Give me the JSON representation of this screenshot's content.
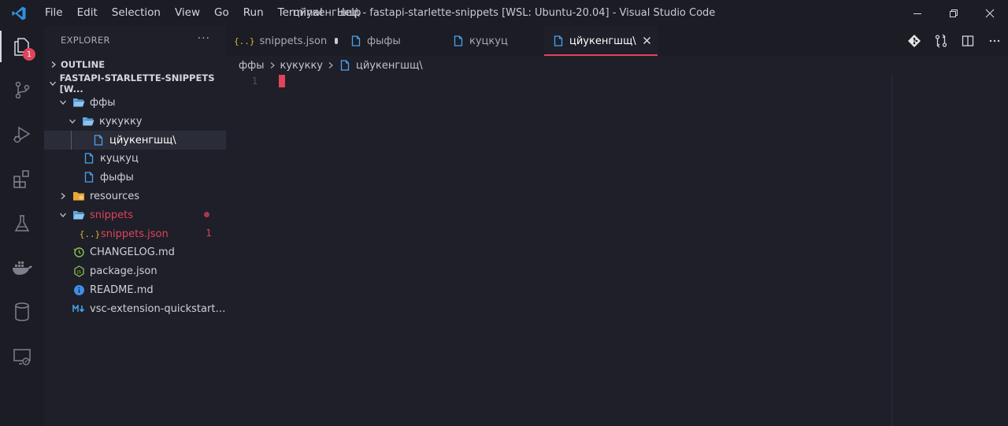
{
  "window": {
    "title": "цйукенгшщ\\ - fastapi-starlette-snippets [WSL: Ubuntu-20.04] - Visual Studio Code"
  },
  "menu": [
    "File",
    "Edit",
    "Selection",
    "View",
    "Go",
    "Run",
    "Terminal",
    "Help"
  ],
  "activity_bar": {
    "items": [
      "explorer-icon",
      "source-control-icon",
      "run-debug-icon",
      "extensions-icon",
      "testing-icon",
      "docker-icon",
      "database-icon",
      "remote-explorer-icon"
    ],
    "explorer_badge": "1"
  },
  "sidebar": {
    "header": "EXPLORER",
    "more": "···",
    "outline_label": "OUTLINE",
    "workspace_label": "FASTAPI-STARLETTE-SNIPPETS [W...",
    "tree": [
      {
        "label": "ффы"
      },
      {
        "label": "кукукку"
      },
      {
        "label": "цйукенгшщ\\"
      },
      {
        "label": "куцкуц"
      },
      {
        "label": "фыфы"
      },
      {
        "label": "resources"
      },
      {
        "label": "snippets"
      },
      {
        "label": "snippets.json",
        "problems": "1"
      },
      {
        "label": "CHANGELOG.md"
      },
      {
        "label": "package.json"
      },
      {
        "label": "README.md"
      },
      {
        "label": "vsc-extension-quickstart...."
      }
    ]
  },
  "tabs": [
    {
      "label": "snippets.json"
    },
    {
      "label": "фыфы"
    },
    {
      "label": "куцкуц"
    },
    {
      "label": "цйукенгшщ\\"
    }
  ],
  "breadcrumb": [
    "ффы",
    "кукукку",
    "цйукенгшщ\\"
  ],
  "editor": {
    "line_number": "1"
  },
  "colors": {
    "accent": "#e0435c",
    "background": "#1e1f28",
    "chrome": "#1b1c24",
    "folder": "#5aa6e6",
    "file_icon": "#4aa3f0",
    "json_icon": "#e0b533"
  }
}
